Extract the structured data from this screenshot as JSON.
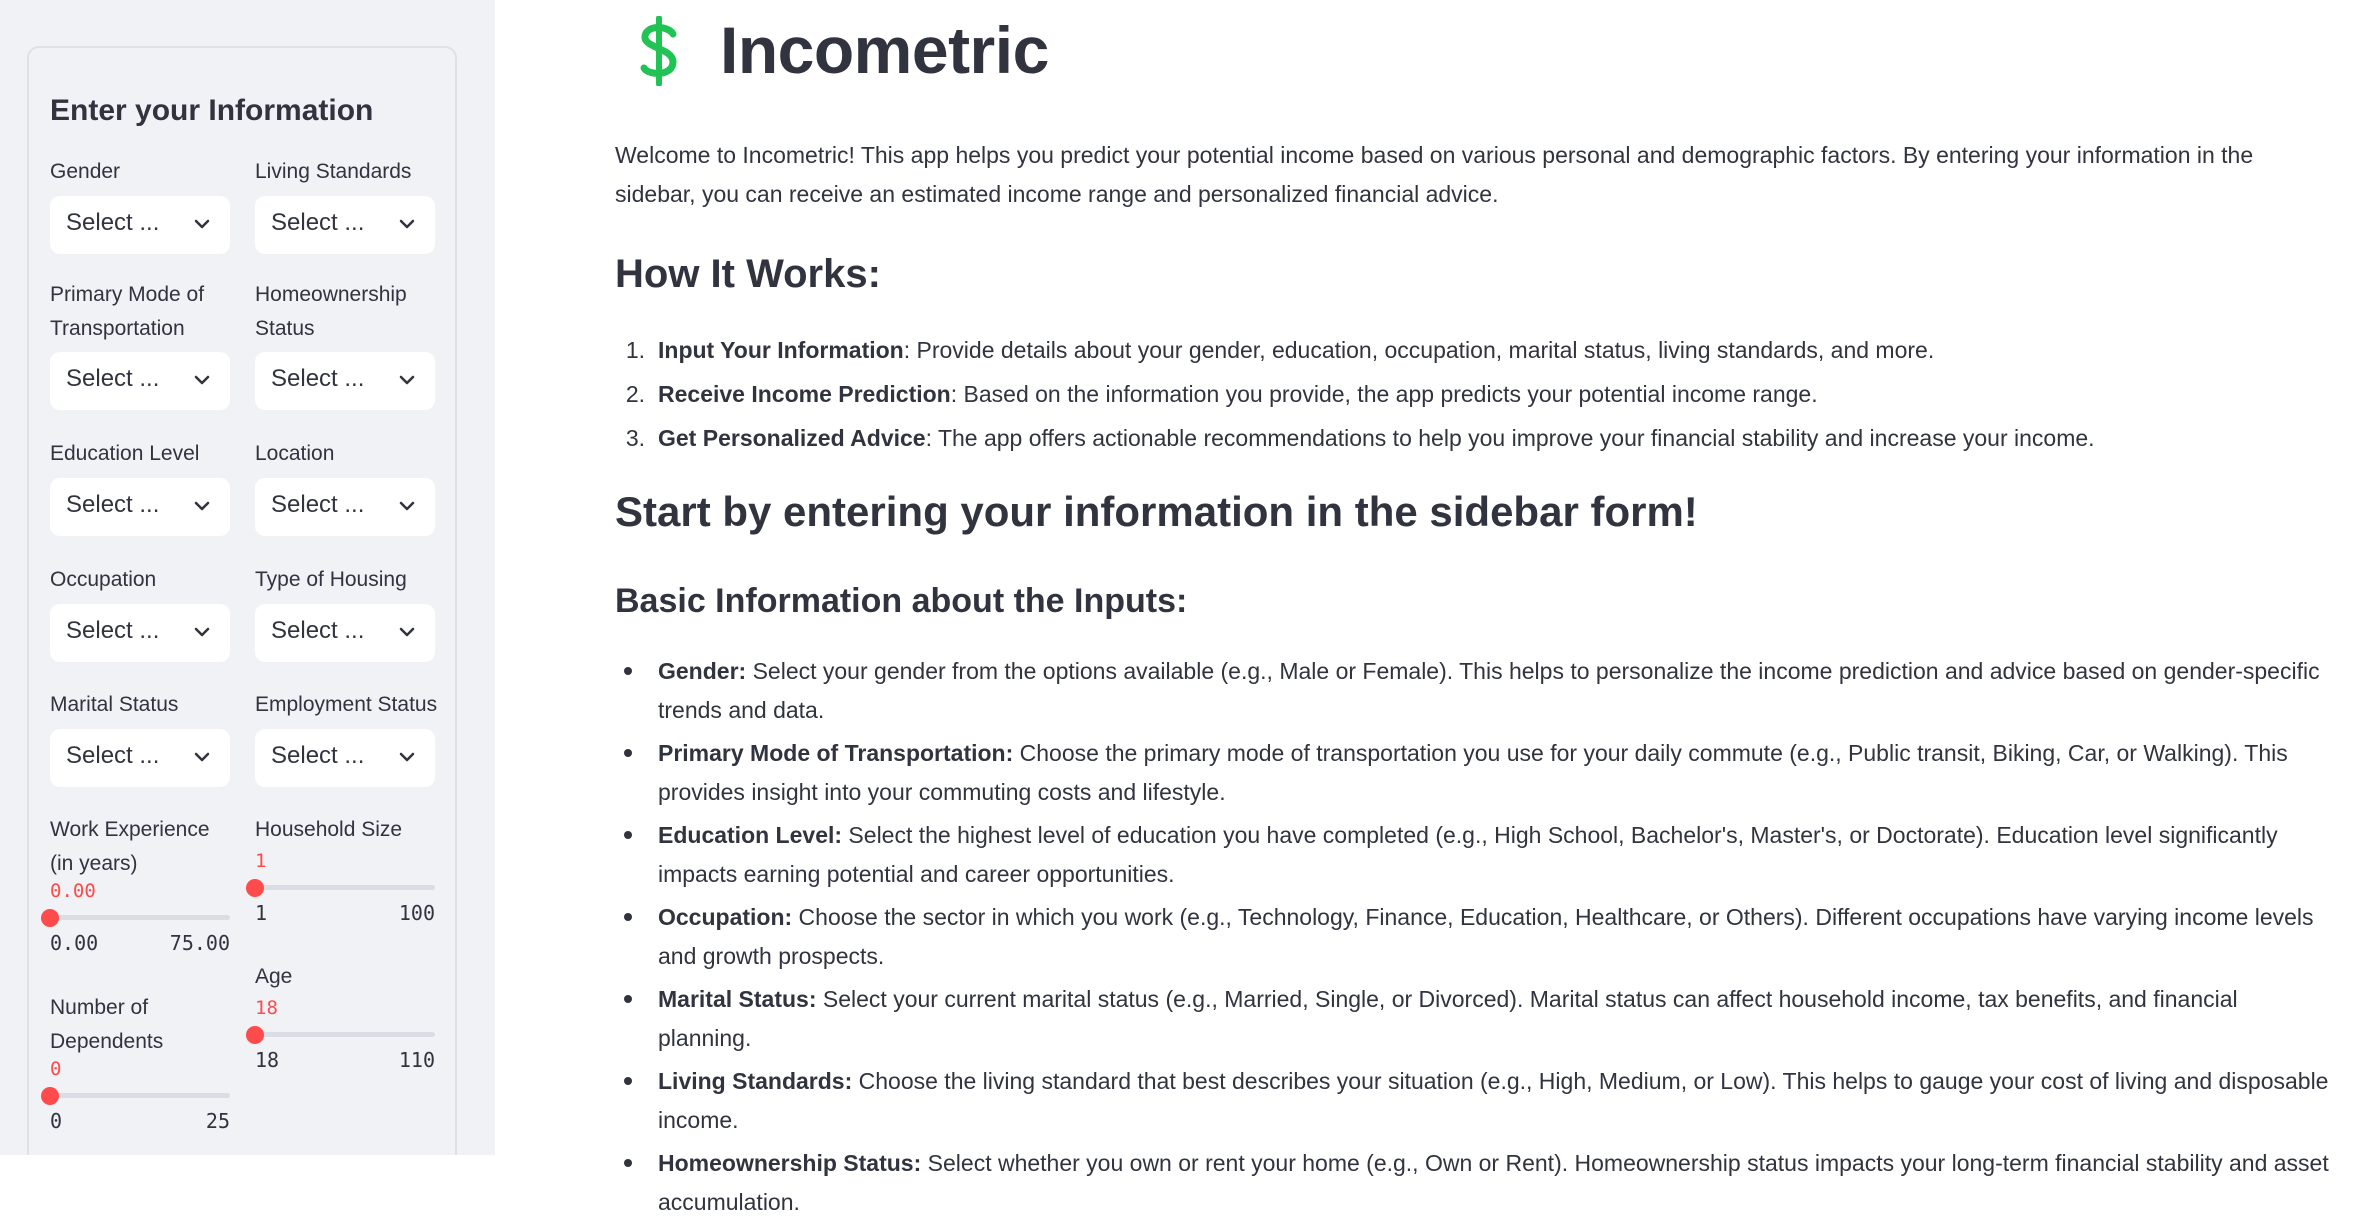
{
  "sidebar": {
    "title": "Enter your Information",
    "fields": {
      "gender": {
        "label": "Gender",
        "value": "Select ..."
      },
      "living_standards": {
        "label": "Living Standards",
        "value": "Select ..."
      },
      "transportation": {
        "label": "Primary Mode of Transportation",
        "value": "Select ..."
      },
      "homeownership": {
        "label": "Homeownership Status",
        "value": "Select ..."
      },
      "education": {
        "label": "Education Level",
        "value": "Select ..."
      },
      "location": {
        "label": "Location",
        "value": "Select ..."
      },
      "occupation": {
        "label": "Occupation",
        "value": "Select ..."
      },
      "housing_type": {
        "label": "Type of Housing",
        "value": "Select ..."
      },
      "marital": {
        "label": "Marital Status",
        "value": "Select ..."
      },
      "employment": {
        "label": "Employment Status",
        "value": "Select ..."
      }
    },
    "sliders": {
      "work_experience": {
        "label": "Work Experience (in years)",
        "value": "0.00",
        "min": "0.00",
        "max": "75.00",
        "fraction": 0
      },
      "household_size": {
        "label": "Household Size",
        "value": "1",
        "min": "1",
        "max": "100",
        "fraction": 0
      },
      "age": {
        "label": "Age",
        "value": "18",
        "min": "18",
        "max": "110",
        "fraction": 0
      },
      "dependents": {
        "label": "Number of Dependents",
        "value": "0",
        "min": "0",
        "max": "25",
        "fraction": 0
      }
    }
  },
  "main": {
    "app_icon": "dollar-sign-icon",
    "title": "Incometric",
    "intro": "Welcome to Incometric! This app helps you predict your potential income based on various personal and demographic factors. By entering your information in the sidebar, you can receive an estimated income range and personalized financial advice.",
    "how_it_works_heading": "How It Works:",
    "steps": [
      {
        "num": "1.",
        "bold": "Input Your Information",
        "text": ": Provide details about your gender, education, occupation, marital status, living standards, and more."
      },
      {
        "num": "2.",
        "bold": "Receive Income Prediction",
        "text": ": Based on the information you provide, the app predicts your potential income range."
      },
      {
        "num": "3.",
        "bold": "Get Personalized Advice",
        "text": ": The app offers actionable recommendations to help you improve your financial stability and increase your income."
      }
    ],
    "cta_heading": "Start by entering your information in the sidebar form!",
    "inputs_heading": "Basic Information about the Inputs:",
    "inputs": [
      {
        "bold": "Gender:",
        "text": " Select your gender from the options available (e.g., Male or Female). This helps to personalize the income prediction and advice based on gender-specific trends and data."
      },
      {
        "bold": "Primary Mode of Transportation:",
        "text": " Choose the primary mode of transportation you use for your daily commute (e.g., Public transit, Biking, Car, or Walking). This provides insight into your commuting costs and lifestyle."
      },
      {
        "bold": "Education Level:",
        "text": " Select the highest level of education you have completed (e.g., High School, Bachelor's, Master's, or Doctorate). Education level significantly impacts earning potential and career opportunities."
      },
      {
        "bold": "Occupation:",
        "text": " Choose the sector in which you work (e.g., Technology, Finance, Education, Healthcare, or Others). Different occupations have varying income levels and growth prospects."
      },
      {
        "bold": "Marital Status:",
        "text": " Select your current marital status (e.g., Married, Single, or Divorced). Marital status can affect household income, tax benefits, and financial planning."
      },
      {
        "bold": "Living Standards:",
        "text": " Choose the living standard that best describes your situation (e.g., High, Medium, or Low). This helps to gauge your cost of living and disposable income."
      },
      {
        "bold": "Homeownership Status:",
        "text": " Select whether you own or rent your home (e.g., Own or Rent). Homeownership status impacts your long-term financial stability and asset accumulation."
      }
    ]
  },
  "colors": {
    "accent": "#ff4b4b",
    "dollar_icon": "#21c354",
    "sidebar_bg": "#f0f2f6"
  }
}
